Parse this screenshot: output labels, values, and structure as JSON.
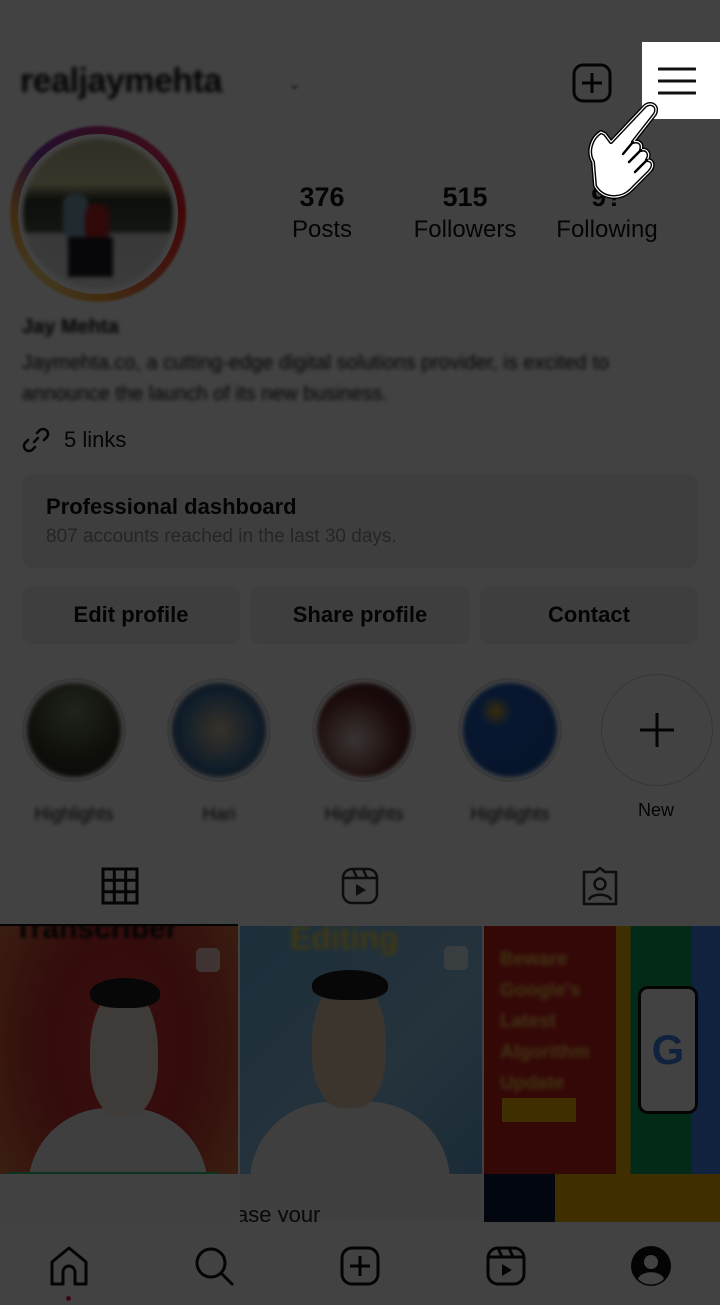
{
  "header": {
    "username": "realjaymehta",
    "username_chevron": "chevron-down-icon",
    "create_icon": "plus-square-icon",
    "menu_icon": "hamburger-menu-icon",
    "pointer_hint": "pointing-hand-icon"
  },
  "profile": {
    "stats": [
      {
        "value": "376",
        "label": "Posts"
      },
      {
        "value": "515",
        "label": "Followers"
      },
      {
        "value": "9?",
        "label": "Following"
      }
    ],
    "name": "Jay Mehta",
    "bio": "Jaymehta.co, a cutting-edge digital solutions provider, is excited to announce the launch of its new business.",
    "links_label": "5 links"
  },
  "dashboard": {
    "title": "Professional dashboard",
    "subtitle": "807 accounts reached in the last 30 days."
  },
  "actions": {
    "edit": "Edit profile",
    "share": "Share profile",
    "contact": "Contact"
  },
  "highlights": [
    {
      "label": "Highlights",
      "colors": [
        "#3a3a2a",
        "#6b7a5a",
        "#1f2a1a"
      ]
    },
    {
      "label": "Hari",
      "colors": [
        "#3a6fa0",
        "#d8c0a0",
        "#4a3030"
      ]
    },
    {
      "label": "Highlights",
      "colors": [
        "#d8c8c0",
        "#6a2a2a",
        "#2a1a1a"
      ]
    },
    {
      "label": "Highlights",
      "colors": [
        "#1e4fa0",
        "#1a5ab8",
        "#e0b030"
      ]
    },
    {
      "label": "New"
    }
  ],
  "tabs": [
    {
      "name": "posts",
      "icon": "grid-icon",
      "active": true
    },
    {
      "name": "reels",
      "icon": "reels-icon",
      "active": false
    },
    {
      "name": "tagged",
      "icon": "tagged-person-icon",
      "active": false
    }
  ],
  "posts": [
    {
      "title": "Transcriber",
      "caption_partial": ""
    },
    {
      "title": "Editing",
      "caption_partial": "ase your"
    },
    {
      "title": "Google",
      "lines": [
        "Beware",
        "Google's",
        "Latest",
        "Algorithm",
        "Update"
      ]
    }
  ],
  "bottom_nav": [
    {
      "name": "home",
      "icon": "home-icon",
      "active": true
    },
    {
      "name": "search",
      "icon": "search-icon"
    },
    {
      "name": "create",
      "icon": "plus-square-icon"
    },
    {
      "name": "reels",
      "icon": "reels-icon"
    },
    {
      "name": "profile",
      "icon": "profile-icon"
    }
  ],
  "colors": {
    "overlay": "#000000",
    "notification_dot": "#e0245e",
    "text_primary": "#111111",
    "text_secondary": "#8e8e8e",
    "button_bg": "#efefef"
  }
}
